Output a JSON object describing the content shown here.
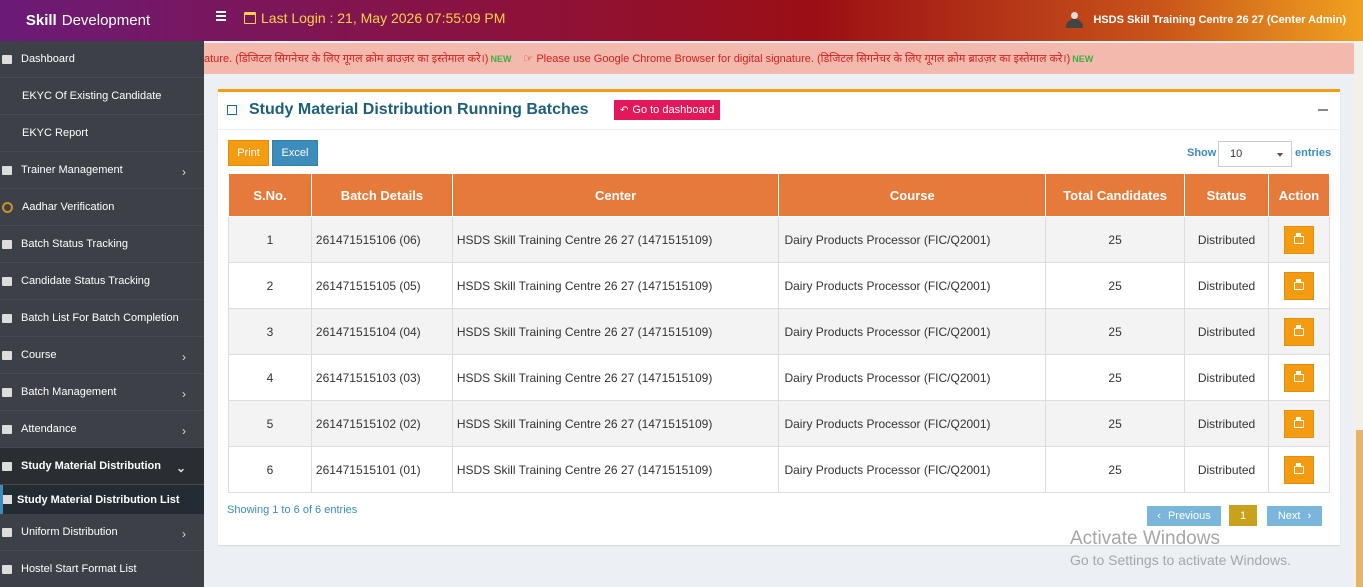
{
  "header": {
    "brand_bold": "Skill",
    "brand_rest": "Development",
    "last_login": "Last Login :  21, May 2026 07:55:09 PM",
    "user": "HSDS Skill Training Centre 26 27 (Center Admin)"
  },
  "sidebar": {
    "items": [
      {
        "label": "Dashboard"
      },
      {
        "label": "EKYC Of Existing Candidate"
      },
      {
        "label": "EKYC Report"
      },
      {
        "label": "Trainer Management"
      },
      {
        "label": "Aadhar Verification"
      },
      {
        "label": "Batch Status Tracking"
      },
      {
        "label": "Candidate Status Tracking"
      },
      {
        "label": "Batch List For Batch Completion"
      },
      {
        "label": "Course"
      },
      {
        "label": "Batch Management"
      },
      {
        "label": "Attendance"
      },
      {
        "label": "Study Material Distribution"
      },
      {
        "label": "Uniform Distribution"
      },
      {
        "label": "Hostel Start Format List"
      }
    ],
    "sub_item": "Study Material Distribution List"
  },
  "marquee": {
    "seg1": "ature. (डिजिटल सिगनेचर के लिए गूगल क्रोम ब्राउज़र का इस्तेमाल करे।)",
    "seg2": "Please use Google Chrome Browser for digital signature. (डिजिटल सिगनेचर के लिए गूगल क्रोम ब्राउज़र का इस्तेमाल करे।)",
    "new": "NEW"
  },
  "panel": {
    "title": "Study Material Distribution Running Batches",
    "dashboard_button": "Go to dashboard",
    "print": "Print",
    "excel": "Excel",
    "show": "Show",
    "page_size": "10",
    "entries": "entries",
    "showing": "Showing 1 to 6 of 6 entries",
    "prev": "Previous",
    "page": "1",
    "next": "Next"
  },
  "table": {
    "headers": [
      "S.No.",
      "Batch Details",
      "Center",
      "Course",
      "Total Candidates",
      "Status",
      "Action"
    ],
    "rows": [
      {
        "sno": "1",
        "batch": "261471515106 (06)",
        "center": "HSDS Skill Training Centre 26 27 (1471515109)",
        "course": "Dairy Products Processor (FIC/Q2001)",
        "total": "25",
        "status": "Distributed"
      },
      {
        "sno": "2",
        "batch": "261471515105 (05)",
        "center": "HSDS Skill Training Centre 26 27 (1471515109)",
        "course": "Dairy Products Processor (FIC/Q2001)",
        "total": "25",
        "status": "Distributed"
      },
      {
        "sno": "3",
        "batch": "261471515104 (04)",
        "center": "HSDS Skill Training Centre 26 27 (1471515109)",
        "course": "Dairy Products Processor (FIC/Q2001)",
        "total": "25",
        "status": "Distributed"
      },
      {
        "sno": "4",
        "batch": "261471515103 (03)",
        "center": "HSDS Skill Training Centre 26 27 (1471515109)",
        "course": "Dairy Products Processor (FIC/Q2001)",
        "total": "25",
        "status": "Distributed"
      },
      {
        "sno": "5",
        "batch": "261471515102 (02)",
        "center": "HSDS Skill Training Centre 26 27 (1471515109)",
        "course": "Dairy Products Processor (FIC/Q2001)",
        "total": "25",
        "status": "Distributed"
      },
      {
        "sno": "6",
        "batch": "261471515101 (01)",
        "center": "HSDS Skill Training Centre 26 27 (1471515109)",
        "course": "Dairy Products Processor (FIC/Q2001)",
        "total": "25",
        "status": "Distributed"
      }
    ]
  },
  "watermark": {
    "line1": "Activate Windows",
    "line2": "Go to Settings to activate Windows."
  }
}
